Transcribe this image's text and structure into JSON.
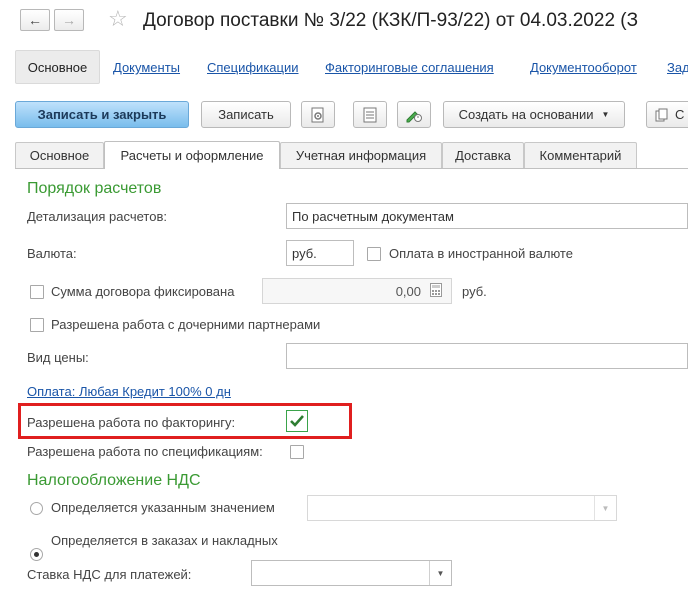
{
  "window": {
    "title": "Договор поставки № 3/22 (КЗК/П-93/22) от 04.03.2022 (З"
  },
  "nav": {
    "back": "←",
    "forward": "→",
    "star": "☆"
  },
  "top_links": [
    "Основное",
    "Документы",
    "Спецификации",
    "Факторинговые соглашения",
    "Документооборот",
    "Зад"
  ],
  "toolbar": {
    "save_close": "Записать и закрыть",
    "save": "Записать",
    "create_based": "Создать на основании",
    "more": "С"
  },
  "tabs": [
    "Основное",
    "Расчеты и оформление",
    "Учетная информация",
    "Доставка",
    "Комментарий"
  ],
  "payment_order": {
    "section": "Порядок расчетов",
    "detail_label": "Детализация расчетов:",
    "detail_value": "По расчетным документам",
    "currency_label": "Валюта:",
    "currency_value": "руб.",
    "foreign_label": "Оплата в иностранной валюте",
    "fixed_sum_label": "Сумма договора фиксирована",
    "fixed_sum_value": "0,00",
    "fixed_sum_currency": "руб.",
    "subsidiaries_label": "Разрешена работа с дочерними партнерами",
    "price_type_label": "Вид цены:",
    "price_type_value": "",
    "payment_link": "Оплата: Любая Кредит 100% 0 дн",
    "factoring_label": "Разрешена работа по факторингу:",
    "specs_label": "Разрешена работа по спецификациям:"
  },
  "vat": {
    "section": "Налогообложение НДС",
    "option_specified": "Определяется указанным значением",
    "option_orders": "Определяется в заказах и накладных",
    "rate_label": "Ставка НДС для платежей:",
    "rate_value": ""
  },
  "colors": {
    "section": "#3a9a33",
    "highlight": "#e01f1f",
    "link": "#1a55a8",
    "primary": "#79bdec"
  }
}
